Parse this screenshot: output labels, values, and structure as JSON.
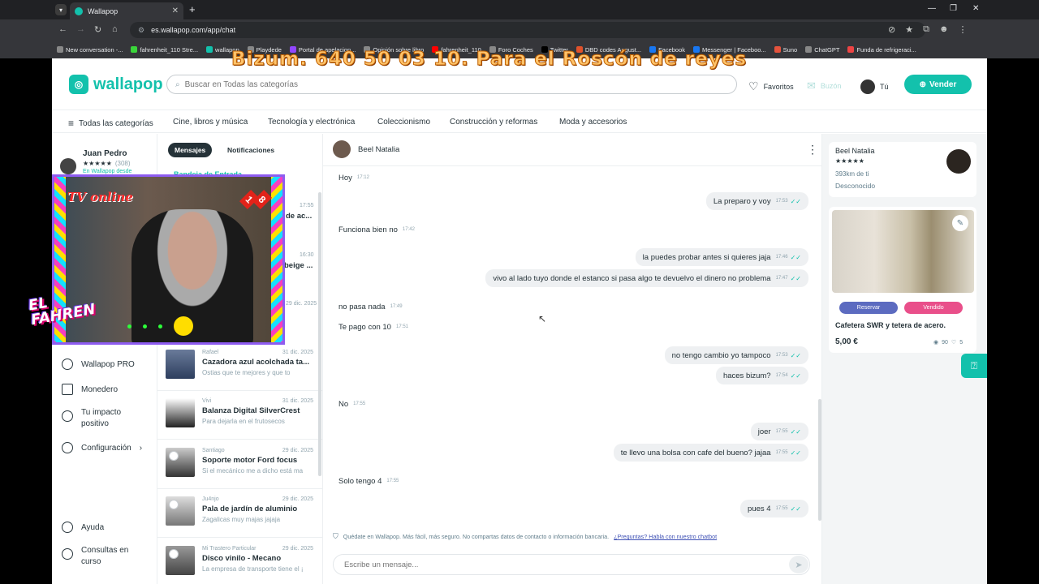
{
  "browser": {
    "tab_title": "Wallapop",
    "url_scheme": "",
    "url": "es.wallapop.com/app/chat",
    "bookmarks": [
      "New conversation -...",
      "fahrenheit_110 Stre...",
      "wallapop",
      "Playdede",
      "Portal de apelacion...",
      "Opinión sobre libro",
      "fahrenheit_110",
      "Foro Coches",
      "Twitter",
      "DBD codes August...",
      "Facebook",
      "Messenger | Faceboo...",
      "Suno",
      "ChatGPT",
      "Funda de refrigeraci..."
    ]
  },
  "overlay": {
    "banner": "Bizum. 640 50 03 10. Para el Roscón de reyes",
    "tv_label": "TV online",
    "age_rating": [
      "1",
      "8"
    ],
    "fahren_label": "EL FAHREN"
  },
  "header": {
    "logo": "wallapop",
    "search_placeholder": "Buscar en Todas las categorías",
    "favorites": "Favoritos",
    "inbox": "Buzón",
    "you": "Tú",
    "sell": "Vender"
  },
  "categories": [
    "Todas las categorías",
    "Cine, libros y música",
    "Tecnología y electrónica",
    "Coleccionismo",
    "Construcción y reformas",
    "Moda y accesorios"
  ],
  "profile": {
    "name": "Juan Pedro",
    "rating_count": "(308)",
    "since": "En Wallapop desde"
  },
  "leftnav": {
    "pro": "Wallapop PRO",
    "wallet": "Monedero",
    "impact": "Tu impacto positivo",
    "config": "Configuración",
    "help": "Ayuda",
    "queries": "Consultas en curso"
  },
  "inbox": {
    "tab_messages": "Mensajes",
    "tab_notifications": "Notificaciones",
    "heading": "Bandeja de Entrada",
    "partial": [
      {
        "date": "17:55",
        "title": "de ac..."
      },
      {
        "date": "16:30",
        "title": "beige ..."
      },
      {
        "date": "29 dic. 2025",
        "title": ""
      }
    ],
    "conversations": [
      {
        "user": "Rafael",
        "date": "31 dic. 2025",
        "title": "Cazadora azul acolchada ta...",
        "preview": "Ostias que te mejores y que to"
      },
      {
        "user": "Vivi",
        "date": "31 dic. 2025",
        "title": "Balanza Digital SilverCrest",
        "preview": "Para dejarla en el frutosecos"
      },
      {
        "user": "Santiago",
        "date": "29 dic. 2025",
        "title": "Soporte motor Ford focus",
        "preview": "Si el mecánico me a dicho está ma"
      },
      {
        "user": "Ju4njo",
        "date": "29 dic. 2025",
        "title": "Pala de jardín de aluminio",
        "preview": "Zagalicas muy majas jajaja"
      },
      {
        "user": "Mi Trastero Particular",
        "date": "29 dic. 2025",
        "title": "Disco vinilo - Mecano",
        "preview": "La empresa de transporte tiene el ¡"
      }
    ]
  },
  "chat": {
    "contact": "Beel Natalia",
    "messages": [
      {
        "dir": "in",
        "text": "Hoy",
        "time": "17:12"
      },
      {
        "dir": "out",
        "text": "La preparo y voy",
        "time": "17:53"
      },
      {
        "dir": "in",
        "text": "Funciona bien no",
        "time": "17:42"
      },
      {
        "dir": "out",
        "text": "la puedes probar antes si quieres jaja",
        "time": "17:46"
      },
      {
        "dir": "out",
        "text": "vivo al lado tuyo donde el estanco si pasa algo te devuelvo el dinero no problema",
        "time": "17:47"
      },
      {
        "dir": "in",
        "text": "no pasa nada",
        "time": "17:49"
      },
      {
        "dir": "in",
        "text": "Te pago con 10",
        "time": "17:51"
      },
      {
        "dir": "out",
        "text": "no tengo cambio yo tampoco",
        "time": "17:53"
      },
      {
        "dir": "out",
        "text": "haces bizum?",
        "time": "17:54"
      },
      {
        "dir": "in",
        "text": "No",
        "time": "17:55"
      },
      {
        "dir": "out",
        "text": "joer",
        "time": "17:55"
      },
      {
        "dir": "out",
        "text": "te llevo una bolsa con cafe del bueno? jajaa",
        "time": "17:55"
      },
      {
        "dir": "in",
        "text": "Solo tengo 4",
        "time": "17:55"
      },
      {
        "dir": "out",
        "text": "pues 4",
        "time": "17:55"
      }
    ],
    "safety_note": "Quédate en Wallapop. Más fácil, más seguro. No compartas datos de contacto o información bancaria.",
    "safety_link": "¿Preguntas? Habla con nuestro chatbot",
    "composer_placeholder": "Escribe un mensaje..."
  },
  "seller": {
    "name": "Beel Natalia",
    "distance": "393km de ti",
    "status": "Desconocido"
  },
  "item": {
    "reserve": "Reservar",
    "sold": "Vendido",
    "title": "Cafetera SWR y tetera de acero.",
    "price": "5,00 €",
    "views": "90",
    "likes": "5"
  },
  "colors": {
    "brand": "#13c1ac",
    "reserve": "#5c6bc0",
    "sold": "#e94f8a"
  }
}
